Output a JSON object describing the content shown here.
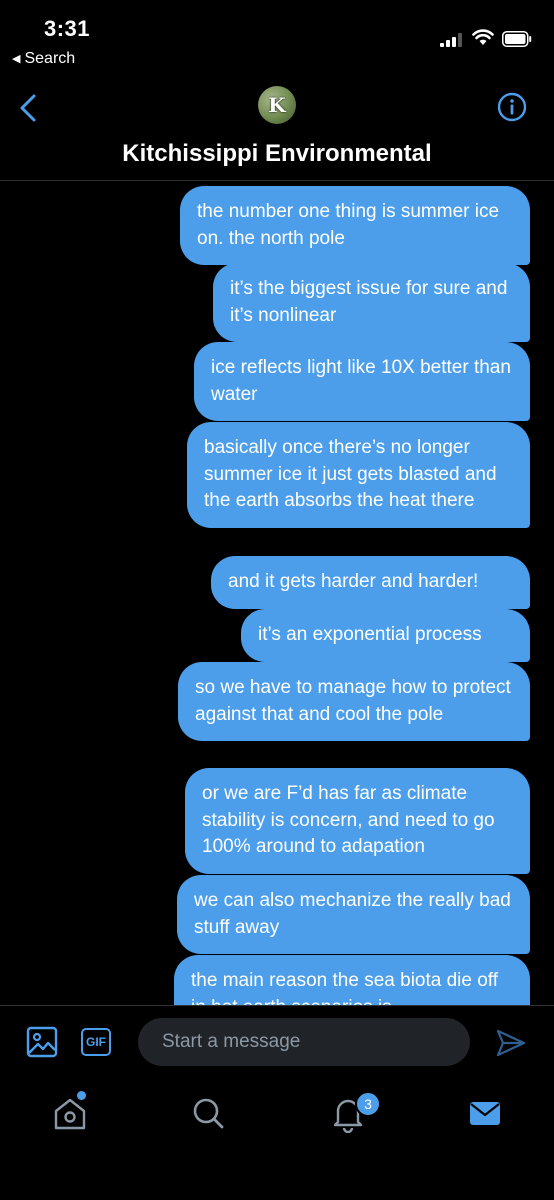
{
  "status_bar": {
    "time": "3:31",
    "back_app_label": "Search"
  },
  "header": {
    "avatar_letter": "K",
    "title": "Kitchissippi Environmental"
  },
  "messages": [
    {
      "text": "the number one thing is summer ice on. the north pole"
    },
    {
      "text": "it’s the biggest issue for sure and it’s nonlinear"
    },
    {
      "text": "ice reflects light like 10X better than water"
    },
    {
      "text": "basically once there’s no longer summer ice it just gets blasted and the earth absorbs the heat there"
    },
    {
      "text": "and it gets harder and harder!"
    },
    {
      "text": "it’s an exponential process"
    },
    {
      "text": "so we have to manage how to protect against that and cool the pole"
    },
    {
      "text": "or we are F’d has far as climate stability is concern, and need to go 100% around to adapation"
    },
    {
      "text": "we can also mechanize the really bad stuff away"
    },
    {
      "text": "the main reason the sea biota die off in hot earth scenarios is"
    }
  ],
  "composer": {
    "gif_label": "GIF",
    "placeholder": "Start a message"
  },
  "tabbar": {
    "notifications_count": "3"
  },
  "colors": {
    "accent": "#4c9eeb",
    "background": "#000000",
    "input_bg": "#202327"
  },
  "icons": [
    "chevron-left-icon",
    "info-icon",
    "image-icon",
    "gif-icon",
    "send-icon",
    "home-icon",
    "search-icon",
    "bell-icon",
    "mail-icon"
  ]
}
